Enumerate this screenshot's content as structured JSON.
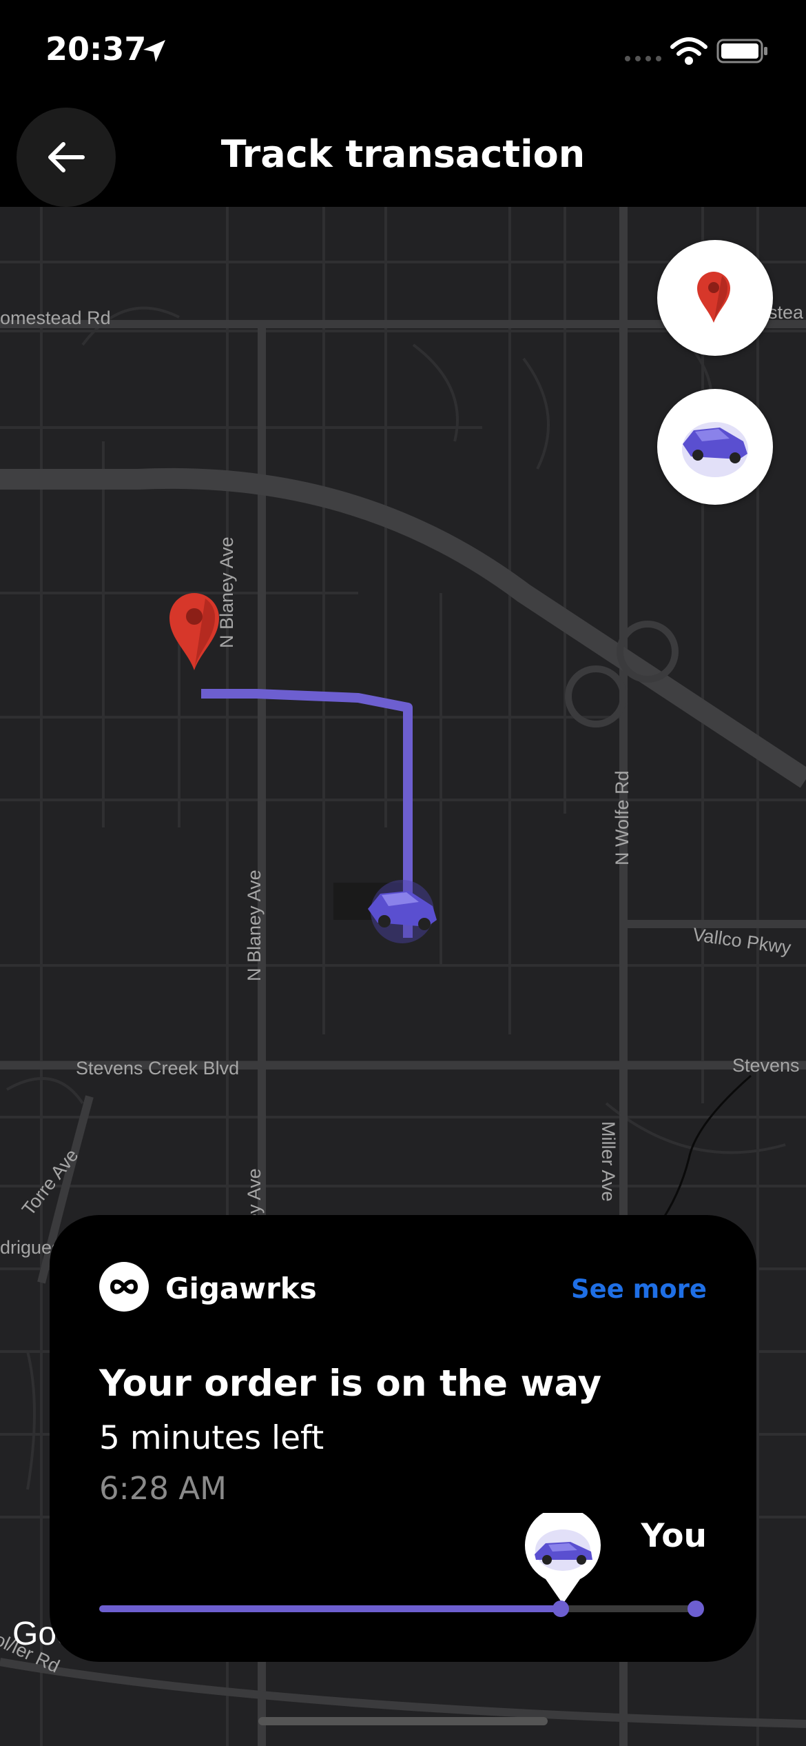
{
  "status_bar": {
    "time": "20:37"
  },
  "header": {
    "title": "Track transaction"
  },
  "map": {
    "streets": {
      "homestead_left": "omestead Rd",
      "homestead_right": "stea",
      "blaney_1": "N Blaney Ave",
      "blaney_2": "N Blaney Ave",
      "blaney_3": "ney Ave",
      "wolfe": "N Wolfe Rd",
      "vallco": "Vallco Pkwy",
      "stevens_left": "Stevens Creek Blvd",
      "stevens_right": "Stevens",
      "torre": "Torre Ave",
      "rodrigues": "drigues",
      "miller": "Miller Ave",
      "bottom_left": "ol/ler Rd"
    },
    "google_logo": "Goo",
    "buttons": {
      "pin_icon": "location-pin-icon",
      "car_icon": "car-icon"
    }
  },
  "order_card": {
    "merchant": "Gigawrks",
    "see_more": "See more",
    "status": "Your order is on the way",
    "time_left": "5 minutes left",
    "eta": "6:28 AM",
    "destination_label": "You",
    "progress": 0.77
  },
  "colors": {
    "route": "#6d5fd0",
    "accent": "#1f6fe5",
    "pin": "#d7372a"
  }
}
